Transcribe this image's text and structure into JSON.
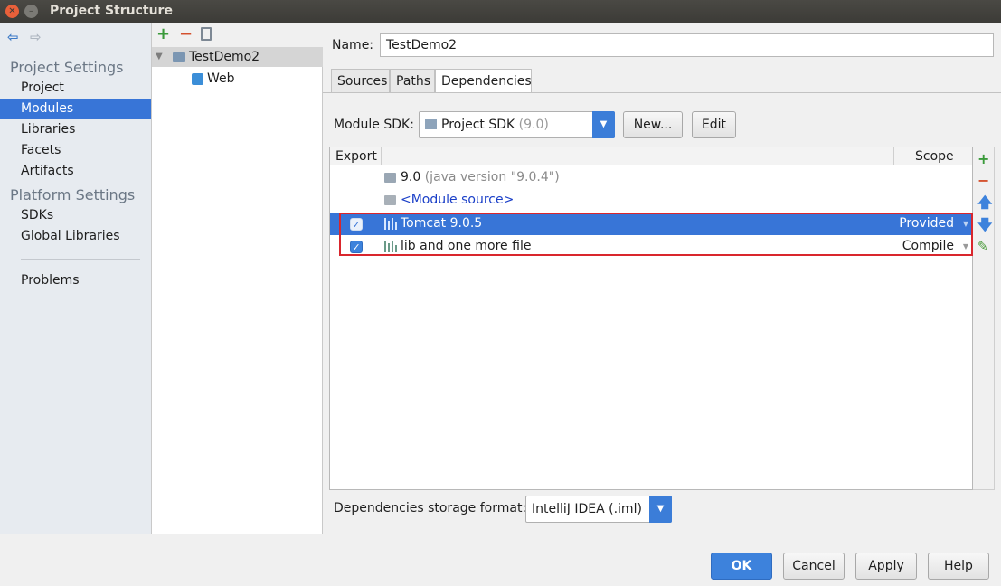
{
  "window": {
    "title": "Project Structure"
  },
  "nav": {
    "project_settings": "Project Settings",
    "project_items": [
      "Project",
      "Modules",
      "Libraries",
      "Facets",
      "Artifacts"
    ],
    "platform_settings": "Platform Settings",
    "platform_items": [
      "SDKs",
      "Global Libraries"
    ],
    "problems": "Problems",
    "selected": "Modules"
  },
  "tree": {
    "module": "TestDemo2",
    "facet": "Web"
  },
  "form": {
    "name_label": "Name:",
    "name_value": "TestDemo2",
    "tabs": [
      "Sources",
      "Paths",
      "Dependencies"
    ],
    "active_tab": "Dependencies",
    "sdk_label": "Module SDK:",
    "sdk_value": "Project SDK",
    "sdk_version": "(9.0)",
    "new_button": "New...",
    "edit_button": "Edit"
  },
  "table": {
    "headers": {
      "export": "Export",
      "scope": "Scope"
    },
    "rows": [
      {
        "name": "9.0",
        "detail": "(java version \"9.0.4\")",
        "scope": "",
        "checked": null
      },
      {
        "name": "<Module source>",
        "detail": "",
        "scope": "",
        "checked": null
      },
      {
        "name": "Tomcat 9.0.5",
        "detail": "",
        "scope": "Provided",
        "checked": true
      },
      {
        "name": "lib and one more file",
        "detail": "",
        "scope": "Compile",
        "checked": true
      }
    ]
  },
  "storage": {
    "label": "Dependencies storage format:",
    "value": "IntelliJ IDEA (.iml)"
  },
  "buttons": {
    "ok": "OK",
    "cancel": "Cancel",
    "apply": "Apply",
    "help": "Help"
  },
  "colors": {
    "accent": "#3875d7",
    "highlight": "#d9262d",
    "add": "#3a9a3a",
    "remove": "#d4502d"
  }
}
